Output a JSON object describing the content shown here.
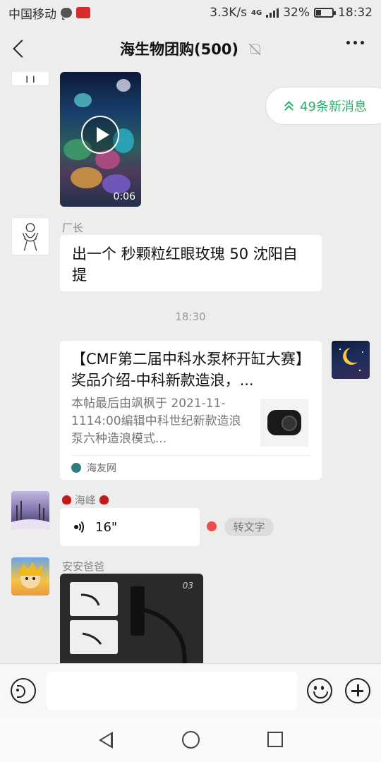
{
  "status_bar": {
    "carrier": "中国移动",
    "network_speed": "3.3K/s",
    "network_type": "4G",
    "battery_percent": "32%",
    "time": "18:32"
  },
  "nav": {
    "title": "海生物团购(500)"
  },
  "new_messages": {
    "label": "49条新消息",
    "color": "#2bad6a"
  },
  "messages": [
    {
      "type": "video",
      "duration": "0:06"
    },
    {
      "type": "text",
      "sender": "厂长",
      "text": "出一个 秒颗粒红眼玫瑰 50 沈阳自提"
    },
    {
      "type": "time",
      "text": "18:30"
    },
    {
      "type": "link",
      "title": "【CMF第二届中科水泵杯开缸大赛】奖品介绍-中科新款造浪，...",
      "description": "本帖最后由飒枫于 2021-11-1114:00编辑中科世纪新款造浪泵六种造浪模式...",
      "source": "海友网"
    },
    {
      "type": "voice",
      "sender_name": "海峰",
      "duration": "16\"",
      "transcribe_label": "转文字"
    },
    {
      "type": "image",
      "sender": "安安爸爸",
      "overlay_text": "03"
    }
  ],
  "input": {
    "placeholder": ""
  },
  "colors": {
    "accent_green": "#2bad6a",
    "unread_red": "#f04a4a",
    "chat_bg": "#ededed"
  }
}
